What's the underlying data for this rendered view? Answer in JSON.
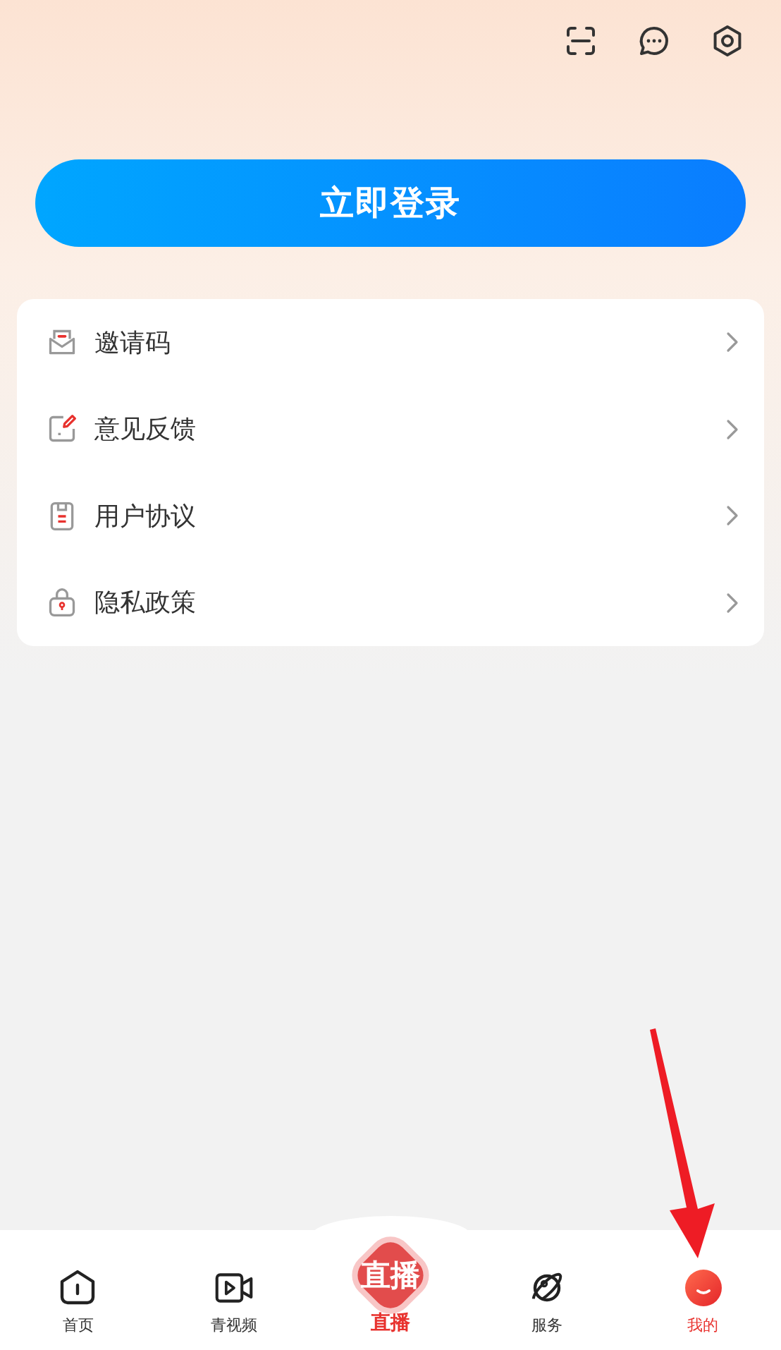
{
  "header": {
    "actions": [
      {
        "kind": "scan"
      },
      {
        "kind": "message"
      },
      {
        "kind": "settings"
      }
    ]
  },
  "login_button": "立即登录",
  "menu": [
    {
      "kind": "invite",
      "label": "邀请码"
    },
    {
      "kind": "feedback",
      "label": "意见反馈"
    },
    {
      "kind": "agreement",
      "label": "用户协议"
    },
    {
      "kind": "privacy",
      "label": "隐私政策"
    }
  ],
  "tabs": [
    {
      "kind": "home",
      "label": "首页",
      "selected": false
    },
    {
      "kind": "video",
      "label": "青视频",
      "selected": false
    },
    {
      "kind": "live",
      "badge": "直播",
      "label": "直播",
      "selected": false
    },
    {
      "kind": "service",
      "label": "服务",
      "selected": false
    },
    {
      "kind": "me",
      "label": "我的",
      "selected": true
    }
  ]
}
